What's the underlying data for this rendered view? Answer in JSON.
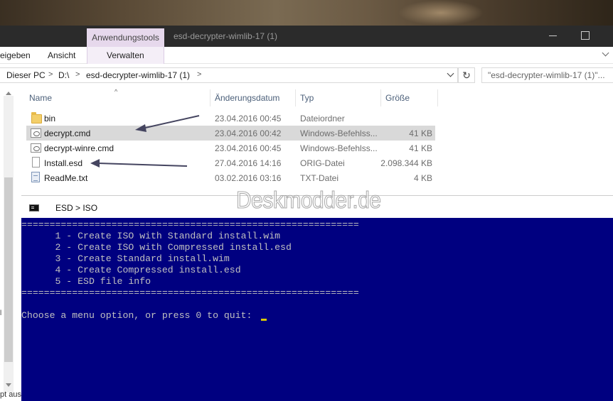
{
  "explorer": {
    "context_tab": "Anwendungstools",
    "window_title": "esd-decrypter-wimlib-17 (1)",
    "ribbon": {
      "tabs": [
        "eigeben",
        "Ansicht",
        "Verwalten"
      ]
    },
    "address": {
      "crumbs": [
        "Dieser PC",
        "D:\\",
        "esd-decrypter-wimlib-17 (1)"
      ],
      "separator": ">",
      "refresh_icon": "↻",
      "search_placeholder": "\"esd-decrypter-wimlib-17 (1)\"..."
    },
    "columns": {
      "name": "Name",
      "date": "Änderungsdatum",
      "type": "Typ",
      "size": "Größe"
    },
    "files": [
      {
        "name": "bin",
        "date": "23.04.2016 00:45",
        "type": "Dateiordner",
        "size": "",
        "icon": "folder-icon"
      },
      {
        "name": "decrypt.cmd",
        "date": "23.04.2016 00:42",
        "type": "Windows-Befehlss...",
        "size": "41 KB",
        "icon": "cmd-file-icon",
        "selected": true
      },
      {
        "name": "decrypt-winre.cmd",
        "date": "23.04.2016 00:45",
        "type": "Windows-Befehlss...",
        "size": "41 KB",
        "icon": "cmd-file-icon"
      },
      {
        "name": "Install.esd",
        "date": "27.04.2016 14:16",
        "type": "ORIG-Datei",
        "size": "2.098.344 KB",
        "icon": "file-icon"
      },
      {
        "name": "ReadMe.txt",
        "date": "03.02.2016 03:16",
        "type": "TXT-Datei",
        "size": "4 KB",
        "icon": "text-file-icon"
      }
    ],
    "nav_cut_text": "pt aus",
    "nav_cut_mark": "l"
  },
  "console": {
    "title": "ESD > ISO",
    "separator": "============================================================",
    "menu": [
      "      1 - Create ISO with Standard install.wim",
      "      2 - Create ISO with Compressed install.esd",
      "      3 - Create Standard install.wim",
      "      4 - Create Compressed install.esd",
      "      5 - ESD file info"
    ],
    "prompt": "Choose a menu option, or press 0 to quit: "
  },
  "watermark": "Deskmodder.de",
  "colors": {
    "console_bg": "#000080",
    "console_text": "#c0c0c0",
    "cursor": "#d8c800",
    "context_tab": "#e6d8ec",
    "selection": "#d9d9d9"
  }
}
